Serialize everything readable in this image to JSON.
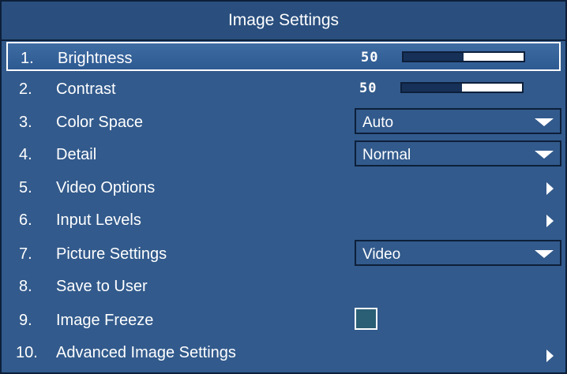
{
  "title": "Image Settings",
  "colors": {
    "panel_bg": "#325a8c",
    "title_bg": "#2a4f7e",
    "border": "#0d1f3a",
    "text": "#ffffff",
    "slider_fill": "#163057"
  },
  "items": [
    {
      "num": "1.",
      "label": "Brightness",
      "control": "slider",
      "value": "50",
      "fill_fraction": 0.5,
      "selected": true
    },
    {
      "num": "2.",
      "label": "Contrast",
      "control": "slider",
      "value": "50",
      "fill_fraction": 0.5
    },
    {
      "num": "3.",
      "label": "Color Space",
      "control": "dropdown",
      "value": "Auto",
      "icon": "chevron-down-icon"
    },
    {
      "num": "4.",
      "label": "Detail",
      "control": "dropdown",
      "value": "Normal",
      "icon": "chevron-down-icon"
    },
    {
      "num": "5.",
      "label": "Video Options",
      "control": "submenu",
      "icon": "chevron-right-icon"
    },
    {
      "num": "6.",
      "label": "Input Levels",
      "control": "submenu",
      "icon": "chevron-right-icon"
    },
    {
      "num": "7.",
      "label": "Picture Settings",
      "control": "dropdown",
      "value": "Video",
      "icon": "chevron-down-icon"
    },
    {
      "num": "8.",
      "label": "Save to User",
      "control": "none"
    },
    {
      "num": "9.",
      "label": "Image Freeze",
      "control": "checkbox",
      "checked": false
    },
    {
      "num": "10.",
      "label": "Advanced Image Settings",
      "control": "submenu",
      "icon": "chevron-right-icon"
    }
  ]
}
